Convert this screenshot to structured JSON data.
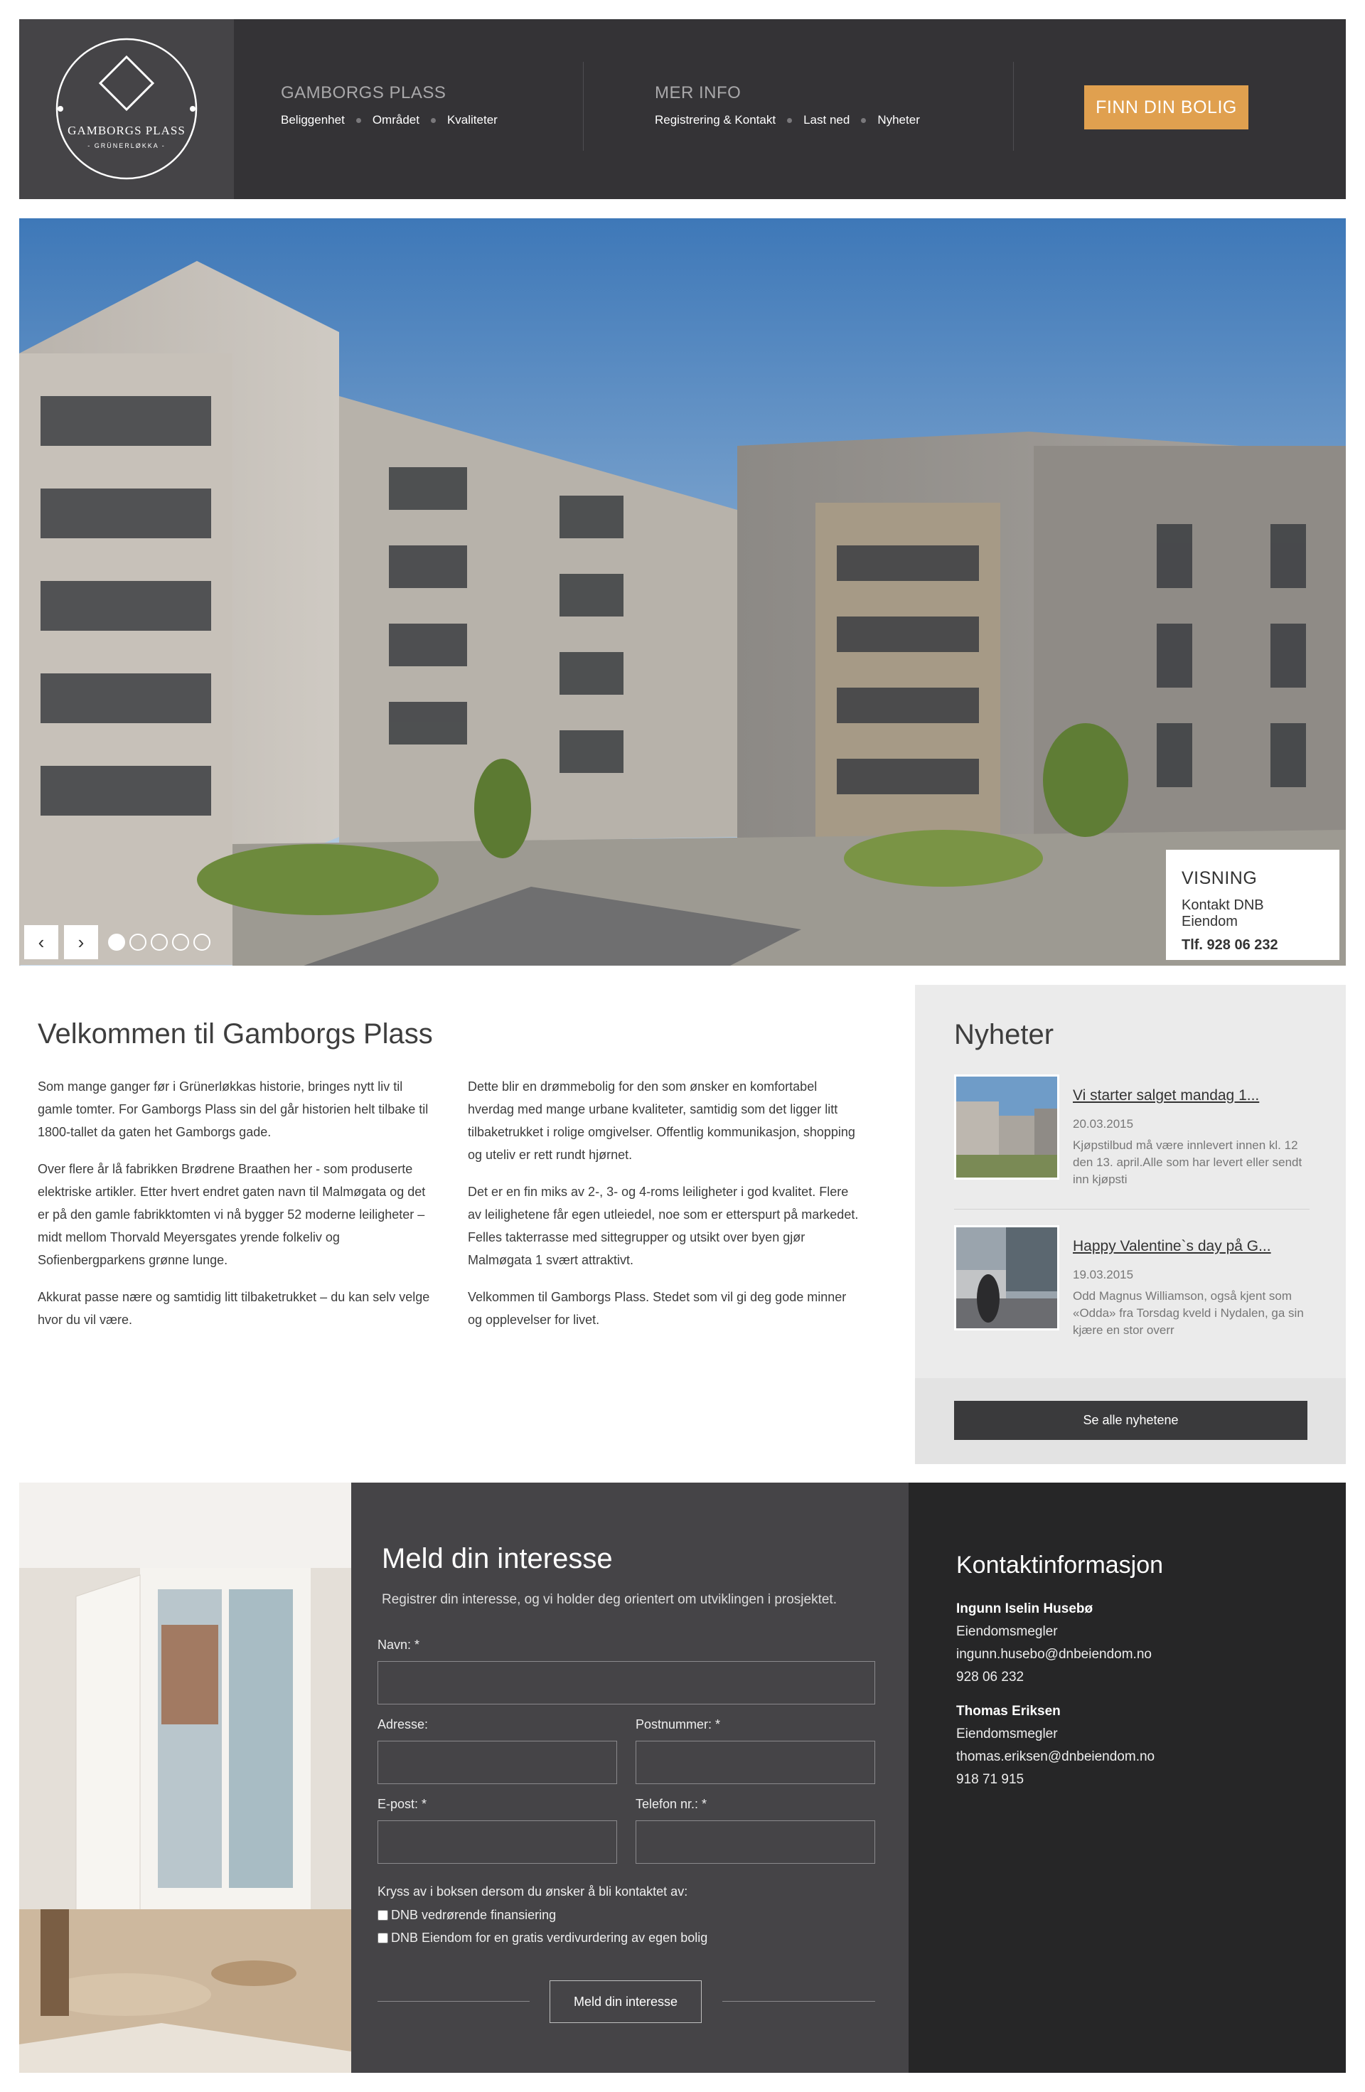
{
  "logo": {
    "title": "GAMBORGS PLASS",
    "subtitle": "- GRÜNERLØKKA -"
  },
  "nav": {
    "group1": {
      "heading": "GAMBORGS PLASS",
      "links": [
        "Beliggenhet",
        "Området",
        "Kvaliteter"
      ]
    },
    "group2": {
      "heading": "MER INFO",
      "links": [
        "Registrering & Kontakt",
        "Last ned",
        "Nyheter"
      ]
    },
    "cta_label": "FINN DIN BOLIG"
  },
  "hero": {
    "prev_label": "‹",
    "next_label": "›",
    "slide_count": 5,
    "active_slide": 1,
    "visning": {
      "heading": "VISNING",
      "contact": "Kontakt DNB Eiendom",
      "phone": "Tlf. 928 06 232"
    }
  },
  "welcome": {
    "title": "Velkommen til Gamborgs Plass",
    "col1": [
      "Som mange ganger før i Grünerløkkas historie, bringes nytt liv til gamle tomter. For Gamborgs Plass sin del går historien helt tilbake til 1800-tallet da gaten het Gamborgs gade.",
      "Over flere år lå fabrikken Brødrene Braathen her - som produserte elektriske artikler. Etter hvert endret gaten navn til Malmøgata og det er på den gamle fabrikktomten vi nå bygger 52 moderne leiligheter – midt mellom Thorvald Meyersgates yrende folkeliv og Sofienbergparkens grønne lunge.",
      "Akkurat passe nære og samtidig litt tilbaketrukket – du kan selv velge hvor du vil være."
    ],
    "col2": [
      "Dette blir en drømmebolig for den som ønsker en komfortabel hverdag med mange urbane kvaliteter, samtidig som det ligger litt tilbaketrukket i rolige omgivelser. Offentlig kommunikasjon, shopping og uteliv er rett rundt hjørnet.",
      "Det er en fin miks av 2-, 3- og 4-roms leiligheter i god kvalitet. Flere av leilighetene får egen utleiedel, noe som er etterspurt på markedet. Felles takterrasse med sittegrupper og utsikt over byen gjør Malmøgata 1 svært attraktivt.",
      "Velkommen til Gamborgs Plass. Stedet som vil gi deg gode minner og opplevelser for livet."
    ]
  },
  "news": {
    "title": "Nyheter",
    "items": [
      {
        "title": "Vi starter salget mandag 1...",
        "date": "20.03.2015",
        "text": "Kjøpstilbud må være innlevert innen kl. 12 den 13. april.Alle som har levert eller sendt inn kjøpsti"
      },
      {
        "title": "Happy Valentine`s day på G...",
        "date": "19.03.2015",
        "text": "Odd Magnus Williamson, også kjent som «Odda» fra Torsdag kveld i Nydalen, ga sin kjære en stor overr"
      }
    ],
    "all_label": "Se alle nyhetene"
  },
  "form": {
    "title": "Meld din interesse",
    "intro": "Registrer din interesse, og vi holder deg orientert om utviklingen i prosjektet.",
    "labels": {
      "name": "Navn: *",
      "address": "Adresse:",
      "postal": "Postnummer: *",
      "email": "E-post: *",
      "phone": "Telefon nr.: *"
    },
    "values": {
      "name": "",
      "address": "",
      "postal": "",
      "email": "",
      "phone": ""
    },
    "checkbox_intro": "Kryss av i boksen dersom du ønsker å bli kontaktet av:",
    "checkboxes": [
      "DNB vedrørende finansiering",
      "DNB Eiendom for en gratis verdivurdering av egen bolig"
    ],
    "submit_label": "Meld din interesse"
  },
  "contact": {
    "title": "Kontaktinformasjon",
    "people": [
      {
        "name": "Ingunn Iselin Husebø",
        "role": "Eiendomsmegler",
        "email": "ingunn.husebo@dnbeiendom.no",
        "phone": "928 06 232"
      },
      {
        "name": "Thomas Eriksen",
        "role": "Eiendomsmegler",
        "email": "thomas.eriksen@dnbeiendom.no",
        "phone": "918 71 915"
      }
    ]
  },
  "colors": {
    "header_bg": "#343336",
    "logo_bg": "#454447",
    "accent": "#e0a04f",
    "news_bg": "#ebebeb",
    "form_bg": "#454447",
    "contact_bg": "#262627"
  }
}
